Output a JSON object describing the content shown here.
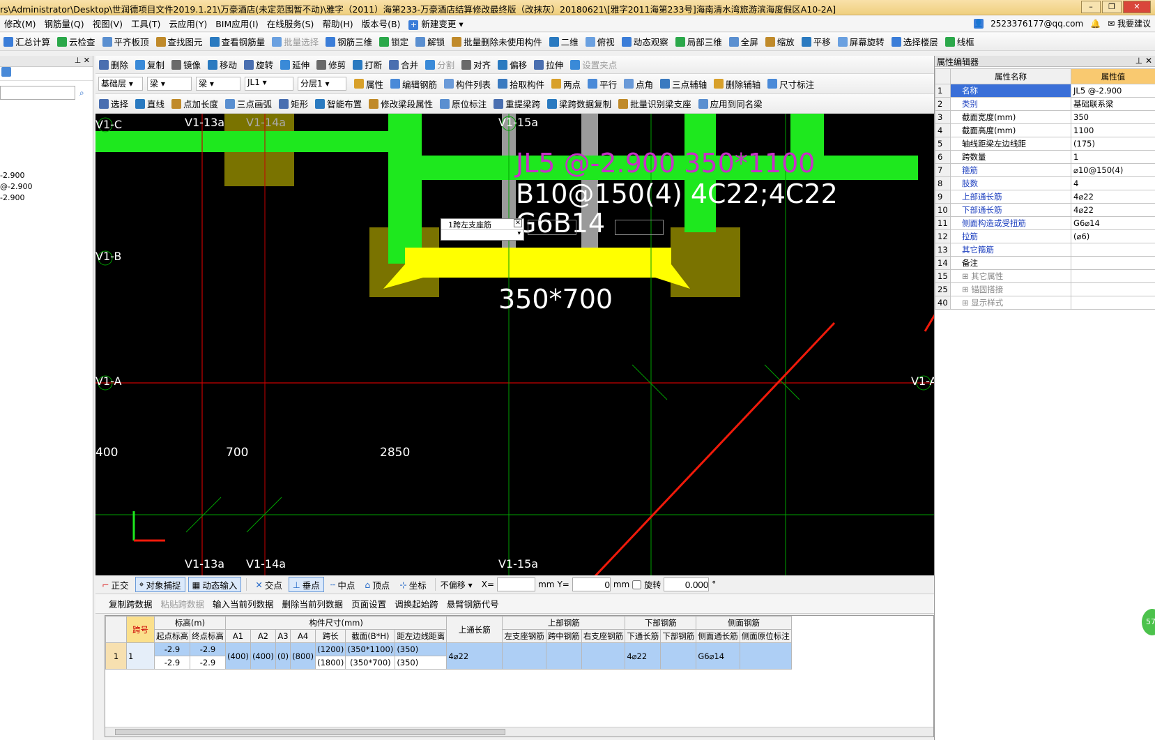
{
  "window": {
    "title": "rs\\Administrator\\Desktop\\世润德项目文件2019.1.21\\万豪酒店(未定范围暂不动)\\雅字（2011）海第233-万豪酒店结算修改最终版（改抹灰）20180621\\[雅字2011海第233号]海南清水湾旅游滨海度假区A10-2A]"
  },
  "menu": [
    "修改(M)",
    "钢筋量(Q)",
    "视图(V)",
    "工具(T)",
    "云应用(Y)",
    "BIM应用(I)",
    "在线服务(S)",
    "帮助(H)",
    "版本号(B)",
    "新建变更"
  ],
  "account": {
    "email": "2523376177@qq.com",
    "feedback": "我要建议"
  },
  "toolbar1": [
    "汇总计算",
    "云检查",
    "平齐板顶",
    "查找图元",
    "查看钢筋量",
    "批量选择",
    "钢筋三维",
    "锁定",
    "解锁",
    "批量删除未使用构件",
    "二维",
    "俯视",
    "动态观察",
    "局部三维",
    "全屏",
    "缩放",
    "平移",
    "屏幕旋转",
    "选择楼层",
    "线框"
  ],
  "toolbar2": [
    "删除",
    "复制",
    "镜像",
    "移动",
    "旋转",
    "延伸",
    "修剪",
    "打断",
    "合并",
    "分割",
    "对齐",
    "偏移",
    "拉伸",
    "设置夹点"
  ],
  "toolbar3": {
    "floor": "基础层",
    "type1": "梁",
    "type2": "梁",
    "name": "JL1",
    "layer": "分层1",
    "buttons": [
      "属性",
      "编辑钢筋",
      "构件列表",
      "拾取构件",
      "两点",
      "平行",
      "点角",
      "三点辅轴",
      "删除辅轴",
      "尺寸标注"
    ]
  },
  "toolbar4": [
    "选择",
    "直线",
    "点加长度",
    "三点画弧",
    "矩形",
    "智能布置",
    "修改梁段属性",
    "原位标注",
    "重提梁跨",
    "梁跨数据复制",
    "批量识别梁支座",
    "应用到同名梁"
  ],
  "left_panel": {
    "items": [
      "-2.900",
      "@-2.900",
      "-2.900"
    ]
  },
  "canvas": {
    "axis_labels_top": [
      "V1-13a",
      "V1-14a",
      "V1-15a"
    ],
    "axis_labels_bottom": [
      "V1-13a",
      "V1-14a",
      "V1-15a"
    ],
    "axis_labels_left": [
      "V1-C",
      "V1-B",
      "V1-A"
    ],
    "axis_label_right": "V1-A",
    "beam_label_line1": "JL5 @-2.900 350*1100",
    "beam_label_line2a": "B10@150(4) ",
    "beam_label_line2b": "4C22;4C22",
    "beam_label_line3": "G6B14",
    "section_label": "350*700",
    "popup_label": "1跨左支座筋",
    "dims": [
      "400",
      "700",
      "2850"
    ]
  },
  "snap_bar": {
    "items": [
      "正交",
      "对象捕捉",
      "动态输入",
      "交点",
      "垂点",
      "中点",
      "顶点",
      "坐标"
    ],
    "offset": "不偏移",
    "x_label": "X=",
    "y_label": "Y=",
    "x_value": "",
    "y_value": "0",
    "unit": "mm",
    "rotate_label": "旋转",
    "rotate_value": "0.000",
    "degree": "°"
  },
  "grid_bar": [
    "复制跨数据",
    "粘贴跨数据",
    "输入当前列数据",
    "删除当前列数据",
    "页面设置",
    "调换起始跨",
    "悬臂钢筋代号"
  ],
  "span_table": {
    "group_headers": {
      "span": "跨号",
      "elev": "标高(m)",
      "size": "构件尺寸(mm)",
      "top_long": "上通长筋",
      "top": "上部钢筋",
      "bottom": "下部钢筋",
      "side": "侧面钢筋"
    },
    "sub_headers": [
      "起点标高",
      "终点标高",
      "A1",
      "A2",
      "A3",
      "A4",
      "跨长",
      "截面(B*H)",
      "距左边线距离",
      "左支座钢筋",
      "跨中钢筋",
      "右支座钢筋",
      "下通长筋",
      "下部钢筋",
      "侧面通长筋",
      "侧面原位标注"
    ],
    "row_no": "1",
    "span_no": "1",
    "start_elev": [
      "-2.9",
      "-2.9"
    ],
    "end_elev": [
      "-2.9",
      "-2.9"
    ],
    "a1": "(400)",
    "a2": "(400)",
    "a3": "(0)",
    "a4": "(800)",
    "span_len": [
      "(1200)",
      "(1800)"
    ],
    "section": [
      "(350*1100)",
      "(350*700)"
    ],
    "dist_left": [
      "(350)",
      "(350)"
    ],
    "top_long_val": "4⌀22",
    "bottom_long_val": "4⌀22",
    "side_long_val": "G6⌀14"
  },
  "property_editor": {
    "title": "属性编辑器",
    "col_name": "属性名称",
    "col_value": "属性值",
    "rows": [
      {
        "no": "1",
        "name": "名称",
        "value": "JL5 @-2.900"
      },
      {
        "no": "2",
        "name": "类别",
        "value": "基础联系梁"
      },
      {
        "no": "3",
        "name": "截面宽度(mm)",
        "value": "350"
      },
      {
        "no": "4",
        "name": "截面高度(mm)",
        "value": "1100"
      },
      {
        "no": "5",
        "name": "轴线距梁左边线距",
        "value": "(175)"
      },
      {
        "no": "6",
        "name": "跨数量",
        "value": "1"
      },
      {
        "no": "7",
        "name": "箍筋",
        "value": "⌀10@150(4)"
      },
      {
        "no": "8",
        "name": "肢数",
        "value": "4"
      },
      {
        "no": "9",
        "name": "上部通长筋",
        "value": "4⌀22"
      },
      {
        "no": "10",
        "name": "下部通长筋",
        "value": "4⌀22"
      },
      {
        "no": "11",
        "name": "侧面构造或受扭筋",
        "value": "G6⌀14"
      },
      {
        "no": "12",
        "name": "拉筋",
        "value": "(⌀6)"
      },
      {
        "no": "13",
        "name": "其它箍筋",
        "value": ""
      },
      {
        "no": "14",
        "name": "备注",
        "value": ""
      },
      {
        "no": "15",
        "name": "其它属性",
        "value": ""
      },
      {
        "no": "25",
        "name": "锚固搭接",
        "value": ""
      },
      {
        "no": "40",
        "name": "显示样式",
        "value": ""
      }
    ]
  },
  "badge": "57",
  "colors": {
    "green": "#1ee81e",
    "yellow": "#ffff00",
    "olive": "#7a7300",
    "magenta": "#c82fc8",
    "red_arrow": "#f01a0a",
    "axis_red": "#c80000",
    "axis_green": "#00a000"
  }
}
